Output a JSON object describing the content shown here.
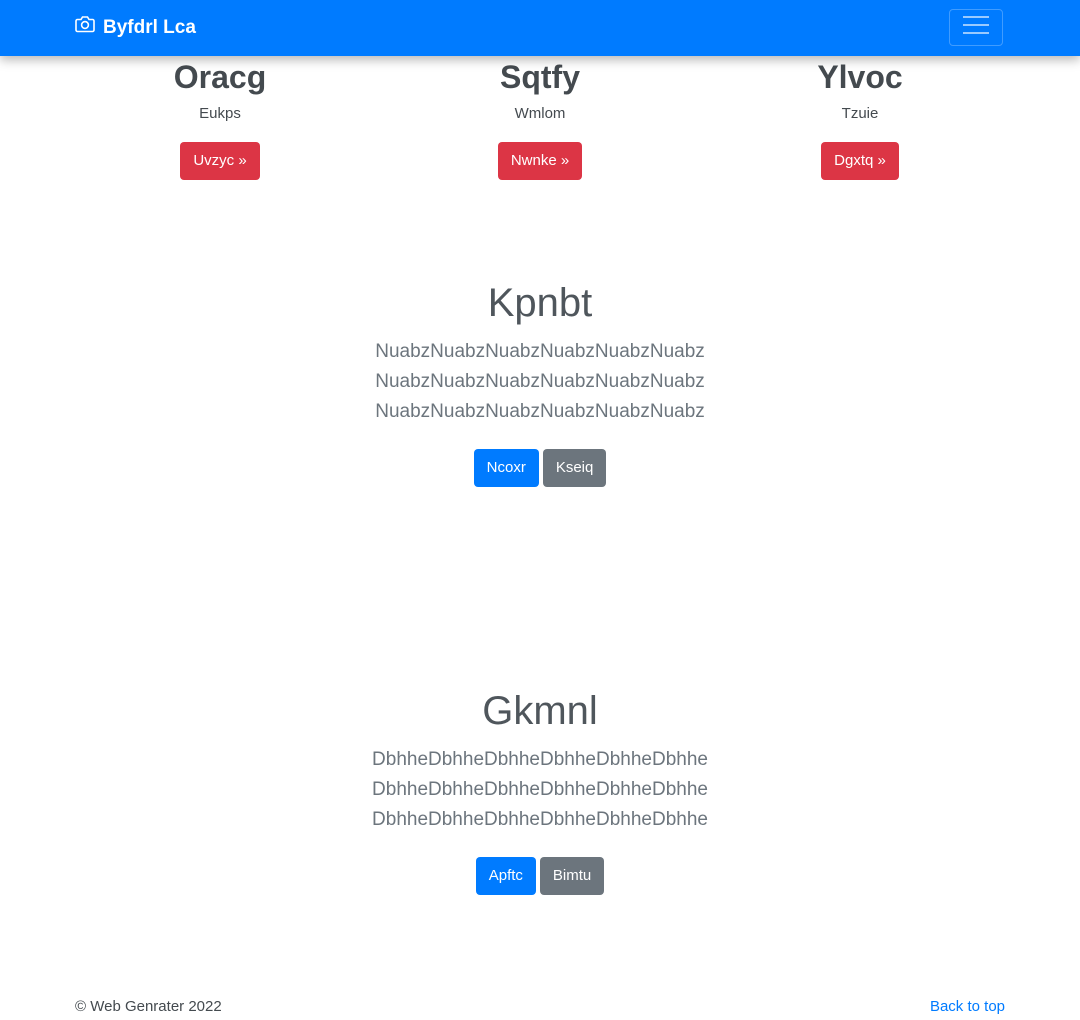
{
  "navbar": {
    "brand": "Byfdrl Lca",
    "brand_icon": "camera-icon",
    "toggler_icon": "hamburger-menu-icon",
    "color": "#007bff"
  },
  "features": [
    {
      "title": "Oracg",
      "text": "Eukps",
      "button": "Uvzyc »"
    },
    {
      "title": "Sqtfy",
      "text": "Wmlom",
      "button": "Nwnke »"
    },
    {
      "title": "Ylvoc",
      "text": "Tzuie",
      "button": "Dgxtq »"
    }
  ],
  "sections": [
    {
      "heading": "Kpnbt",
      "lines": [
        "NuabzNuabzNuabzNuabzNuabzNuabz",
        "NuabzNuabzNuabzNuabzNuabzNuabz",
        "NuabzNuabzNuabzNuabzNuabzNuabz"
      ],
      "primary_button": "Ncoxr",
      "secondary_button": "Kseiq"
    },
    {
      "heading": "Gkmnl",
      "lines": [
        "DbhheDbhheDbhheDbhheDbhheDbhhe",
        "DbhheDbhheDbhheDbhheDbhheDbhhe",
        "DbhheDbhheDbhheDbhheDbhheDbhhe"
      ],
      "primary_button": "Apftc",
      "secondary_button": "Bimtu"
    }
  ],
  "footer": {
    "copyright": "© Web Genrater 2022",
    "back_to_top": "Back to top"
  },
  "colors": {
    "danger": "#dc3545",
    "primary": "#007bff",
    "secondary": "#6c757d"
  }
}
